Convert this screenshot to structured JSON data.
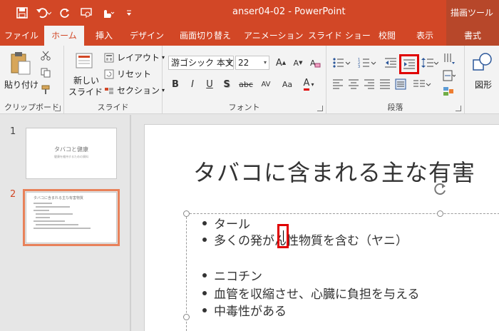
{
  "window": {
    "title": "anser04-02 - PowerPoint",
    "context_group": "描画ツール"
  },
  "qat": {
    "save_icon": "save-icon",
    "undo_icon": "undo-icon",
    "redo_icon": "repeat-icon",
    "present_icon": "present-from-start-icon",
    "touch_icon": "touch-mode-icon",
    "customize_icon": "customize-qat-icon"
  },
  "tabs": [
    {
      "label": "ファイル"
    },
    {
      "label": "ホーム"
    },
    {
      "label": "挿入"
    },
    {
      "label": "デザイン"
    },
    {
      "label": "画面切り替え"
    },
    {
      "label": "アニメーション"
    },
    {
      "label": "スライド ショー"
    },
    {
      "label": "校閲"
    },
    {
      "label": "表示"
    },
    {
      "label": "書式"
    }
  ],
  "ribbon": {
    "clipboard": {
      "paste_label": "貼り付け",
      "group_label": "クリップボード"
    },
    "slides": {
      "new_slide_label_1": "新しい",
      "new_slide_label_2": "スライド",
      "layout_label": "レイアウト",
      "reset_label": "リセット",
      "section_label": "セクション",
      "group_label": "スライド"
    },
    "font": {
      "font_name": "游ゴシック 本文",
      "font_size": "22",
      "bold": "B",
      "italic": "I",
      "underline": "U",
      "shadow": "S",
      "strike": "abc",
      "spacing": "AV",
      "case": "Aa",
      "color": "A",
      "group_label": "フォント"
    },
    "paragraph": {
      "group_label": "段落"
    },
    "drawing": {
      "shapes_label": "図形"
    }
  },
  "thumbnails": [
    {
      "number": "1",
      "title": "タバコと健康",
      "subtitle": "健康を維持するための資料"
    },
    {
      "number": "2",
      "title": "タバコに含まれる主な有害物質"
    }
  ],
  "slide": {
    "title": "タバコに含まれる主な有害",
    "bullets": [
      "タール",
      "多くの発がん性物質を含む（ヤニ）",
      "",
      "ニコチン",
      "血管を収縮させ、心臓に負担を与える",
      "中毒性がある"
    ]
  }
}
